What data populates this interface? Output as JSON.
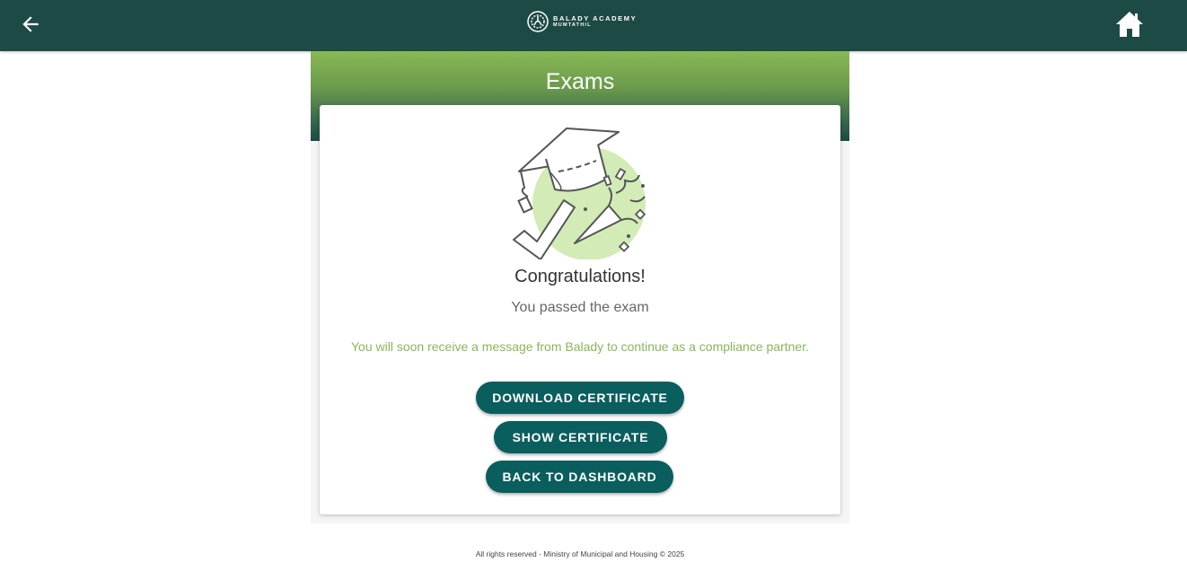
{
  "header": {
    "back_icon": "arrow-left-icon",
    "home_icon": "home-icon",
    "logo": {
      "line1": "BALADY ACADEMY",
      "line2": "MUMTATHIL"
    }
  },
  "page": {
    "title": "Exams"
  },
  "result": {
    "illustration": "graduation-cap-check-celebration",
    "heading": "Congratulations!",
    "status": "You passed the exam",
    "message": "You will soon receive a message from Balady to continue as a compliance partner."
  },
  "actions": {
    "download_label": "DOWNLOAD CERTIFICATE",
    "show_label": "SHOW CERTIFICATE",
    "dashboard_label": "BACK TO DASHBOARD"
  },
  "footer": {
    "text": "All rights reserved - Ministry of Municipal and Housing © 2025"
  },
  "colors": {
    "header_bg": "#1e4a45",
    "banner_top": "#89b856",
    "button_bg": "#0a5e5e",
    "message_text": "#8ab55b",
    "illustration_circle": "#d3ebb6"
  }
}
